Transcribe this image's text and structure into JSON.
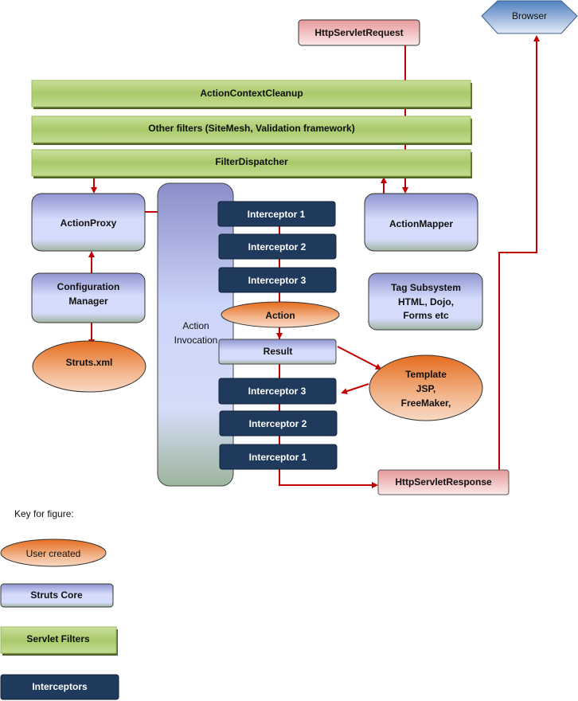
{
  "nodes": {
    "browser": "Browser",
    "http_request": "HttpServletRequest",
    "action_context_cleanup": "ActionContextCleanup",
    "other_filters": "Other filters (SiteMesh, Validation framework)",
    "filter_dispatcher": "FilterDispatcher",
    "action_proxy": "ActionProxy",
    "action_invocation": [
      "Action",
      "Invocation"
    ],
    "interceptors_in": [
      "Interceptor 1",
      "Interceptor 2",
      "Interceptor 3"
    ],
    "action": "Action",
    "result": "Result",
    "interceptors_out": [
      "Interceptor 3",
      "Interceptor 2",
      "Interceptor 1"
    ],
    "configuration_manager": [
      "Configuration",
      "Manager"
    ],
    "struts_xml": "Struts.xml",
    "action_mapper": "ActionMapper",
    "tag_subsystem": [
      "Tag Subsystem",
      "HTML, Dojo,",
      "Forms etc"
    ],
    "template": [
      "Template",
      "JSP,",
      "FreeMaker,"
    ],
    "http_response": "HttpServletResponse"
  },
  "key": {
    "title": "Key for figure:",
    "user_created": "User created",
    "struts_core": "Struts Core",
    "servlet_filters": "Servlet Filters",
    "interceptors": "Interceptors"
  },
  "colors": {
    "arrow": "#c00000",
    "interceptor": "#1f3a5c",
    "servlet_filter": "#9bbb59",
    "user_created": "#e57a3a",
    "struts_core": "#c5cdf5",
    "servlet_io": "#e8a0a0"
  }
}
